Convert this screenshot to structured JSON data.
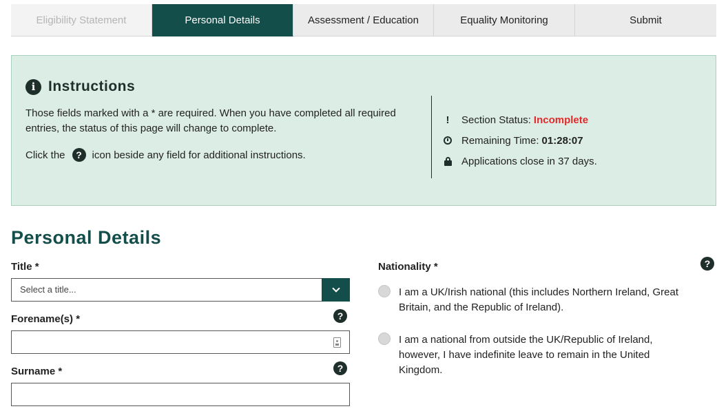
{
  "tabs": [
    {
      "label": "Eligibility Statement",
      "state": "disabled"
    },
    {
      "label": "Personal Details",
      "state": "active"
    },
    {
      "label": "Assessment / Education",
      "state": "default"
    },
    {
      "label": "Equality Monitoring",
      "state": "default"
    },
    {
      "label": "Submit",
      "state": "default"
    }
  ],
  "instructions": {
    "title": "Instructions",
    "text1": "Those fields marked with a * are required. When you have completed all required entries, the status of this page will change to complete.",
    "text2_before": "Click the",
    "text2_after": "icon beside any field for additional instructions.",
    "section_status_label": "Section Status:",
    "section_status_value": "Incomplete",
    "remaining_time_label": "Remaining Time:",
    "remaining_time_value": "01:28:07",
    "close_notice": "Applications close in 37 days."
  },
  "form": {
    "heading": "Personal Details",
    "title_label": "Title *",
    "title_placeholder": "Select a title...",
    "forename_label": "Forename(s) *",
    "surname_label": "Surname *",
    "nationality_label": "Nationality *",
    "nationality_options": [
      "I am a UK/Irish national (this includes Northern Ireland, Great Britain, and the Republic of Ireland).",
      "I am a national from outside the UK/Republic of Ireland, however, I have indefinite leave to remain in the United Kingdom."
    ]
  },
  "colors": {
    "brand_dark": "#144e4a",
    "panel_bg": "#dcede5",
    "status_incomplete": "#e32929"
  },
  "icons": {
    "info": "info-circle-icon",
    "help": "question-circle-icon",
    "status": "exclamation-icon",
    "time": "clock-icon",
    "close": "lock-icon",
    "select": "chevron-down-icon",
    "contact_card": "contact-card-icon"
  }
}
